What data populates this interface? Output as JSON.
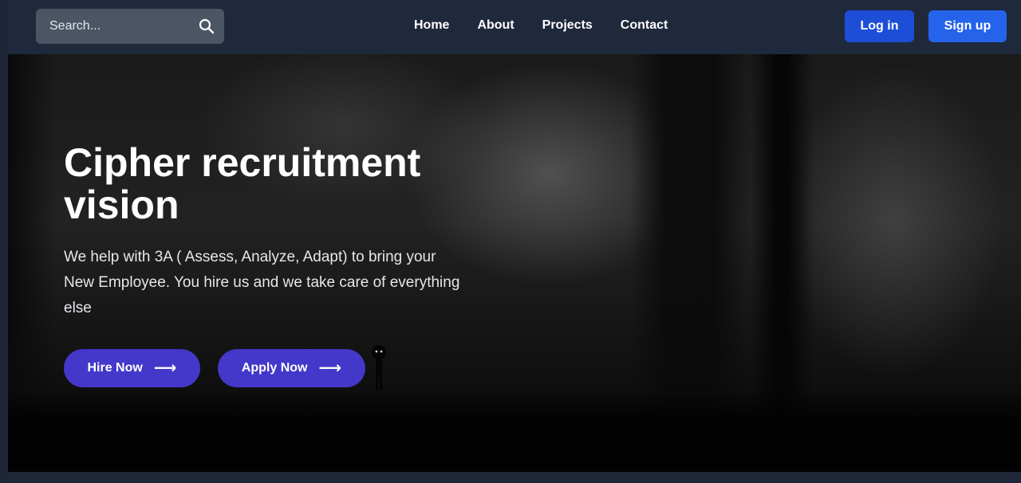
{
  "header": {
    "search": {
      "placeholder": "Search..."
    },
    "nav": [
      "Home",
      "About",
      "Projects",
      "Contact"
    ],
    "login_label": "Log in",
    "signup_label": "Sign up"
  },
  "hero": {
    "title": "Cipher recruitment vision",
    "description": "We help with 3A ( Assess, Analyze, Adapt) to bring your New Employee. You hire us and we take care of everything else",
    "hire_label": "Hire Now",
    "apply_label": "Apply Now",
    "arrow": "⟶"
  },
  "colors": {
    "navbar_bg": "#1f293b",
    "login_btn": "#1d4ed8",
    "signup_btn": "#2563eb",
    "cta_btn": "#4338ca"
  },
  "icons": {
    "search": "magnifier-icon",
    "arrow": "arrow-right-icon"
  }
}
